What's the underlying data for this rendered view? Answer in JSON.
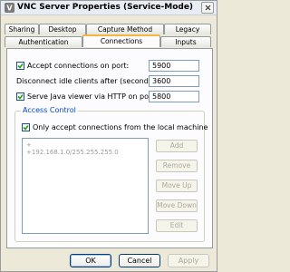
{
  "window": {
    "title": "VNC Server Properties (Service-Mode)"
  },
  "tabs": {
    "row1": [
      "Sharing",
      "Desktop",
      "Capture Method",
      "Legacy"
    ],
    "row2": [
      "Authentication",
      "Connections",
      "Inputs"
    ],
    "active": "Connections"
  },
  "connections": {
    "accept_label": "Accept connections on port:",
    "accept_checked": true,
    "accept_port": "5900",
    "idle_label": "Disconnect idle clients after (seconds):",
    "idle_value": "3600",
    "http_label": "Serve Java viewer via HTTP on port:",
    "http_checked": true,
    "http_port": "5800"
  },
  "access_control": {
    "group_title": "Access Control",
    "local_only_label": "Only accept connections from the local machine",
    "local_only_checked": true,
    "list_items": [
      "+",
      "+192.168.1.0/255.255.255.0"
    ],
    "buttons": {
      "add": "Add",
      "remove": "Remove",
      "move_up": "Move Up",
      "move_down": "Move Down",
      "edit": "Edit"
    }
  },
  "footer": {
    "ok": "OK",
    "cancel": "Cancel",
    "apply": "Apply"
  },
  "colors": {
    "accent_tab": "#f7b440",
    "group_title": "#0046d5",
    "check": "#21a121"
  }
}
